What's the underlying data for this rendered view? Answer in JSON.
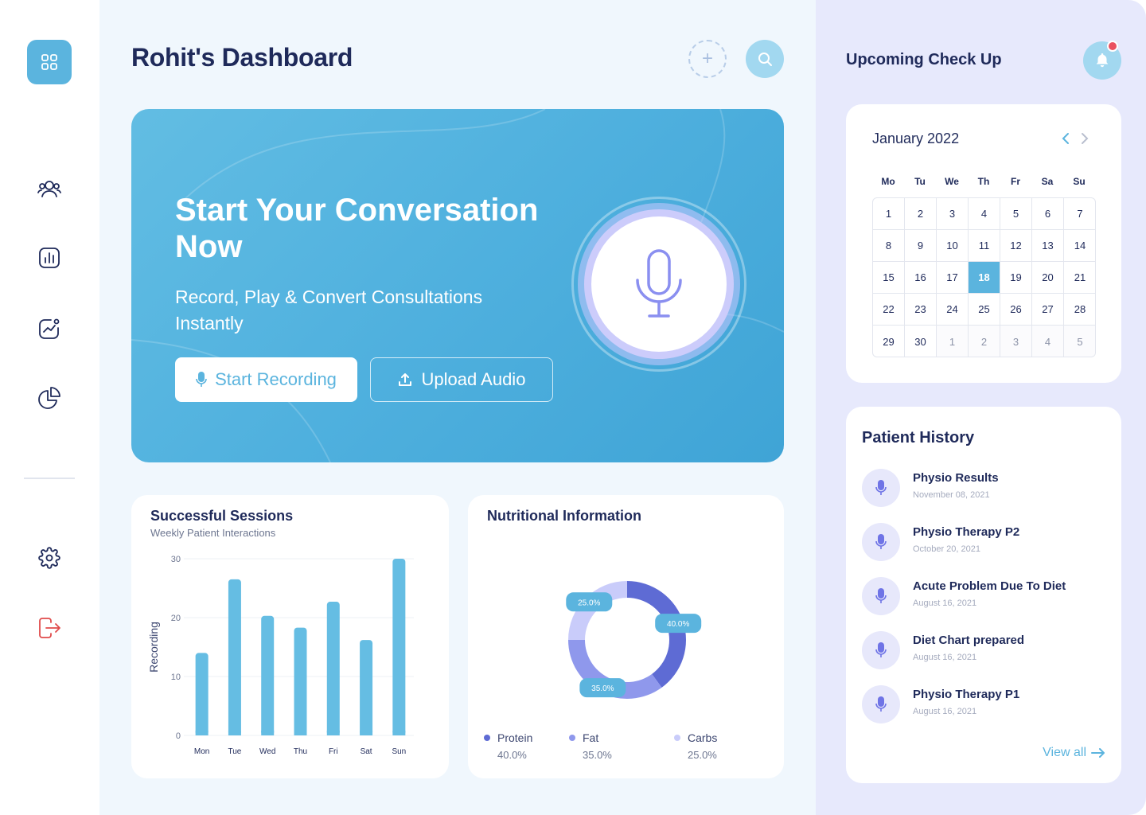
{
  "page": {
    "title": "Rohit's Dashboard"
  },
  "sidebar": {
    "items": [
      {
        "name": "dashboard-icon"
      },
      {
        "name": "patients-icon"
      },
      {
        "name": "reports-icon"
      },
      {
        "name": "analytics-icon"
      },
      {
        "name": "pie-chart-icon"
      },
      {
        "name": "settings-icon"
      },
      {
        "name": "logout-icon"
      }
    ]
  },
  "colors": {
    "accent": "#5bb4de",
    "primary_dark": "#1f2a5a",
    "protein": "#5e6bd4",
    "fat": "#8f98ec",
    "carbs": "#c9ccfa",
    "logout": "#e04b4b"
  },
  "hero": {
    "title": "Start Your Conversation Now",
    "subtitle": "Record, Play & Convert Consultations Instantly",
    "record_label": "Start Recording",
    "upload_label": "Upload Audio"
  },
  "sessions": {
    "title": "Successful Sessions",
    "subtitle": "Weekly Patient Interactions"
  },
  "nutrition": {
    "title": "Nutritional Information",
    "legend": [
      {
        "name": "Protein",
        "value": "40.0%"
      },
      {
        "name": "Fat",
        "value": "35.0%"
      },
      {
        "name": "Carbs",
        "value": "25.0%"
      }
    ]
  },
  "chart_data": [
    {
      "type": "bar",
      "title": "Successful Sessions",
      "subtitle": "Weekly Patient Interactions",
      "categories": [
        "Mon",
        "Tue",
        "Wed",
        "Thu",
        "Fri",
        "Sat",
        "Sun"
      ],
      "values": [
        14,
        26.5,
        20.3,
        18.3,
        22.7,
        16.2,
        30
      ],
      "ylabel": "Recording",
      "xlabel": "",
      "ylim": [
        0,
        30
      ],
      "yticks": [
        0,
        10,
        20,
        30
      ],
      "grid": true
    },
    {
      "type": "pie",
      "title": "Nutritional Information",
      "categories": [
        "Protein",
        "Fat",
        "Carbs"
      ],
      "values": [
        40.0,
        35.0,
        25.0
      ],
      "labels": [
        "40.0%",
        "35.0%",
        "25.0%"
      ],
      "legend": "bottom"
    }
  ],
  "right": {
    "title": "Upcoming Check Up",
    "calendar": {
      "month": "January 2022",
      "prev": "‹",
      "next": "›",
      "dows": [
        "Mo",
        "Tu",
        "We",
        "Th",
        "Fr",
        "Sa",
        "Su"
      ],
      "days": [
        "1",
        "2",
        "3",
        "4",
        "5",
        "6",
        "7",
        "8",
        "9",
        "10",
        "11",
        "12",
        "13",
        "14",
        "15",
        "16",
        "17",
        "18",
        "19",
        "20",
        "21",
        "22",
        "23",
        "24",
        "25",
        "26",
        "27",
        "28",
        "29",
        "30",
        "1",
        "2",
        "3",
        "4",
        "5"
      ],
      "selected": "18"
    },
    "history": {
      "title": "Patient History",
      "items": [
        {
          "name": "Physio Results",
          "date": "November 08, 2021"
        },
        {
          "name": "Physio Therapy P2",
          "date": "October 20, 2021"
        },
        {
          "name": "Acute Problem Due To Diet",
          "date": "August 16, 2021"
        },
        {
          "name": "Diet Chart prepared",
          "date": "August 16, 2021"
        },
        {
          "name": "Physio Therapy P1",
          "date": "August 16, 2021"
        }
      ],
      "view_all": "View all"
    }
  }
}
